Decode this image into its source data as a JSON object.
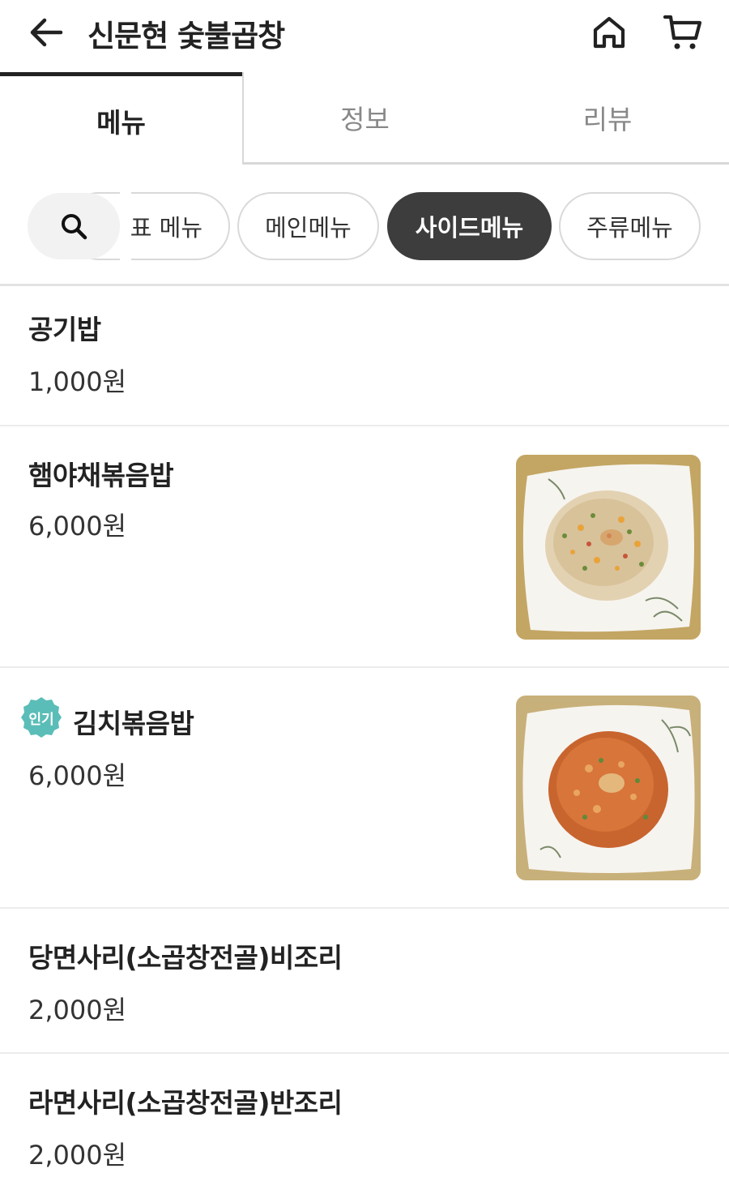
{
  "header": {
    "title": "신문현 숯불곱창",
    "back_icon": "arrow-left-icon",
    "home_icon": "home-icon",
    "cart_icon": "cart-icon"
  },
  "tabs": [
    {
      "label": "메뉴",
      "active": true
    },
    {
      "label": "정보",
      "active": false
    },
    {
      "label": "리뷰",
      "active": false
    }
  ],
  "categories": {
    "search_icon": "search-icon",
    "items": [
      {
        "label": "표 메뉴",
        "active": false
      },
      {
        "label": "메인메뉴",
        "active": false
      },
      {
        "label": "사이드메뉴",
        "active": true
      },
      {
        "label": "주류메뉴",
        "active": false
      }
    ]
  },
  "menu": [
    {
      "name": "공기밥",
      "price": "1,000원"
    },
    {
      "name": "햄야채볶음밥",
      "price": "6,000원",
      "image": "fried-rice-photo"
    },
    {
      "name": "김치볶음밥",
      "price": "6,000원",
      "image": "kimchi-fried-rice-photo",
      "badge": "인기"
    },
    {
      "name": "당면사리(소곱창전골)비조리",
      "price": "2,000원"
    },
    {
      "name": "라면사리(소곱창전골)반조리",
      "price": "2,000원"
    }
  ],
  "colors": {
    "active_chip": "#3d3d3d",
    "badge": "#5bbdb8",
    "divider": "#ececec"
  }
}
